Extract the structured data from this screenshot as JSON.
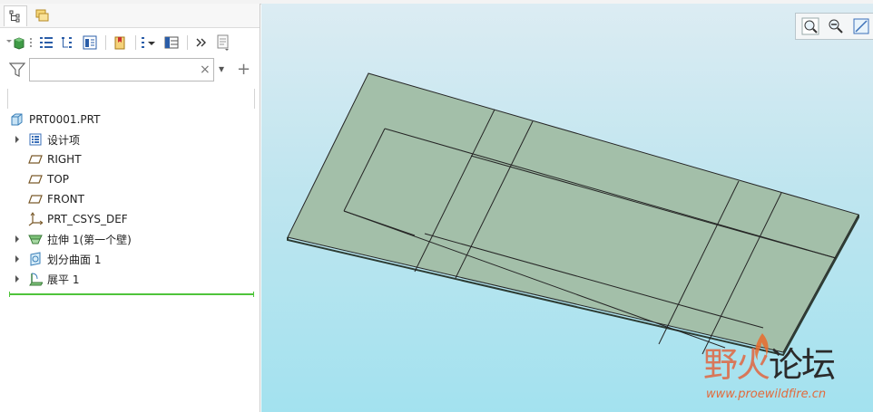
{
  "window": {
    "tabs": [
      {
        "name": "model-tree-tab",
        "icon": "model-tree-icon",
        "active": true
      },
      {
        "name": "layers-tab",
        "icon": "folder-browser-icon",
        "active": false
      }
    ]
  },
  "tree_toolbar": {
    "buttons": [
      "tree-settings-icon",
      "show-icon",
      "tree-columns-icon",
      "tree-filters-icon",
      "bookmark-icon",
      "filter-dropdown-icon",
      "table-icon",
      "more-icon",
      "notes-icon"
    ]
  },
  "filter": {
    "placeholder": "",
    "value": "",
    "clear_glyph": "×",
    "dropdown_glyph": "▾",
    "add_glyph": "+"
  },
  "model_tree": {
    "root": {
      "label": "PRT0001.PRT",
      "icon": "part-icon"
    },
    "items": [
      {
        "label": "设计项",
        "icon": "design-items-icon",
        "expandable": true
      },
      {
        "label": "RIGHT",
        "icon": "datum-plane-icon",
        "expandable": false
      },
      {
        "label": "TOP",
        "icon": "datum-plane-icon",
        "expandable": false
      },
      {
        "label": "FRONT",
        "icon": "datum-plane-icon",
        "expandable": false
      },
      {
        "label": "PRT_CSYS_DEF",
        "icon": "coordinate-system-icon",
        "expandable": false
      },
      {
        "label": "拉伸 1(第一个壁)",
        "icon": "extrude-wall-icon",
        "expandable": true
      },
      {
        "label": "划分曲面 1",
        "icon": "split-surface-icon",
        "expandable": true
      },
      {
        "label": "展平 1",
        "icon": "flatten-icon",
        "expandable": true
      }
    ]
  },
  "view_toolbar": {
    "buttons": [
      "zoom-in-icon",
      "zoom-out-icon",
      "refit-icon"
    ]
  },
  "graphics": {
    "part_color": "#a3bfa9",
    "background_top": "#dcecf3",
    "background_bottom": "#a3e2ef"
  },
  "watermark": {
    "title_accent": "野火",
    "title_rest": "论坛",
    "url": "www.proewildfire.cn"
  }
}
